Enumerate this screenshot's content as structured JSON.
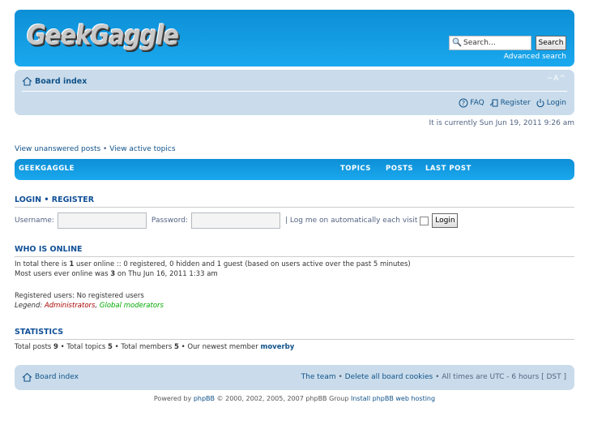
{
  "header": {
    "logo_text": "GeekGaggle",
    "search_placeholder": "Search…",
    "search_button": "Search",
    "advanced_search": "Advanced search"
  },
  "navbar": {
    "board_index": "Board index",
    "font_size_changer": "~A^",
    "faq": "FAQ",
    "register": "Register",
    "login": "Login"
  },
  "current_time": "It is currently Sun Jun 19, 2011 9:26 am",
  "quick_links": {
    "unanswered": "View unanswered posts",
    "separator": " • ",
    "active": "View active topics"
  },
  "forum_bar": {
    "name": "GEEKGAGGLE",
    "topics": "TOPICS",
    "posts": "POSTS",
    "last_post": "LAST POST"
  },
  "login_section": {
    "login": "LOGIN",
    "separator": " • ",
    "register": "REGISTER",
    "username_label": "Username:",
    "password_label": "Password:",
    "autologin_label": "| Log me on automatically each visit",
    "login_button": "Login"
  },
  "who_is_online": {
    "title": "WHO IS ONLINE",
    "line1_pre": "In total there is ",
    "line1_count": "1",
    "line1_post": " user online :: 0 registered, 0 hidden and 1 guest (based on users active over the past 5 minutes)",
    "line2_pre": "Most users ever online was ",
    "line2_count": "3",
    "line2_post": " on Thu Jun 16, 2011 1:33 am",
    "registered_users": "Registered users: No registered users",
    "legend_label": "Legend: ",
    "legend_admin": "Administrators",
    "legend_sep": ", ",
    "legend_globalmod": "Global moderators"
  },
  "statistics": {
    "title": "STATISTICS",
    "total_posts_label": "Total posts ",
    "total_posts": "9",
    "total_topics_label": " • Total topics ",
    "total_topics": "5",
    "total_members_label": " • Total members ",
    "total_members": "5",
    "newest_label": " • Our newest member ",
    "newest_member": "moverby"
  },
  "footer": {
    "board_index": "Board index",
    "the_team": "The team",
    "sep": " • ",
    "delete_cookies": "Delete all board cookies",
    "timezone": " • All times are UTC - 6 hours [ DST ]"
  },
  "copyright": {
    "powered_by": "Powered by ",
    "phpbb": "phpBB",
    "copyright_text": " © 2000, 2002, 2005, 2007 phpBB Group ",
    "hosting": "Install phpBB web hosting"
  },
  "colors": {
    "header_blue": "#12a3eb",
    "navbar_bg": "#cadceb",
    "link": "#105289",
    "admin": "#aa0000",
    "global_mod": "#00aa00"
  }
}
